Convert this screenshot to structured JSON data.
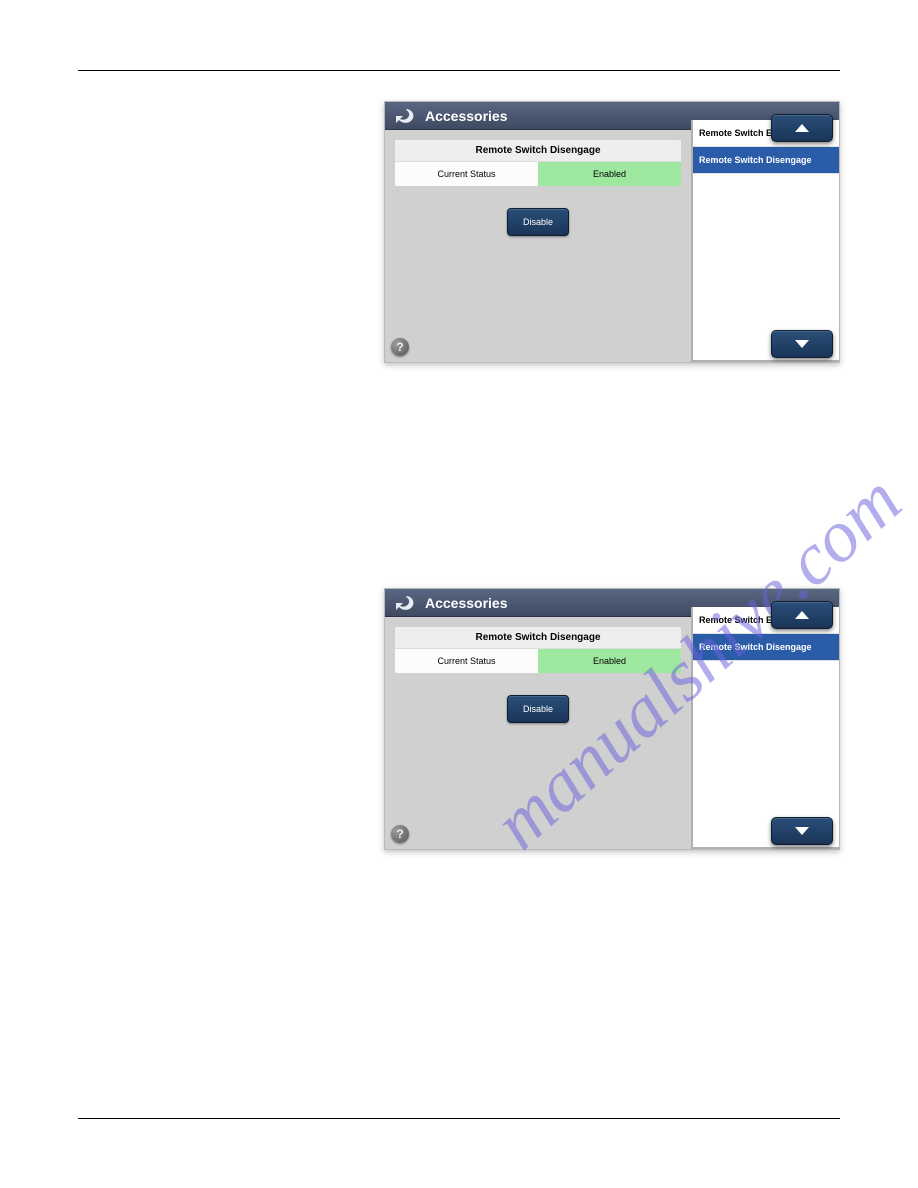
{
  "watermark": "manualshive.com",
  "panel1": {
    "header": "Accessories",
    "card_title": "Remote Switch Disengage",
    "status_label": "Current Status",
    "status_value": "Enabled",
    "button_label": "Disable",
    "side_items": [
      {
        "label": "Remote Switch Engage",
        "selected": false
      },
      {
        "label": "Remote Switch Disengage",
        "selected": true
      }
    ],
    "help": "?"
  },
  "panel2": {
    "header": "Accessories",
    "card_title": "Remote Switch Disengage",
    "status_label": "Current Status",
    "status_value": "Enabled",
    "button_label": "Disable",
    "side_items": [
      {
        "label": "Remote Switch Engage",
        "selected": false
      },
      {
        "label": "Remote Switch Disengage",
        "selected": true
      }
    ],
    "help": "?"
  }
}
